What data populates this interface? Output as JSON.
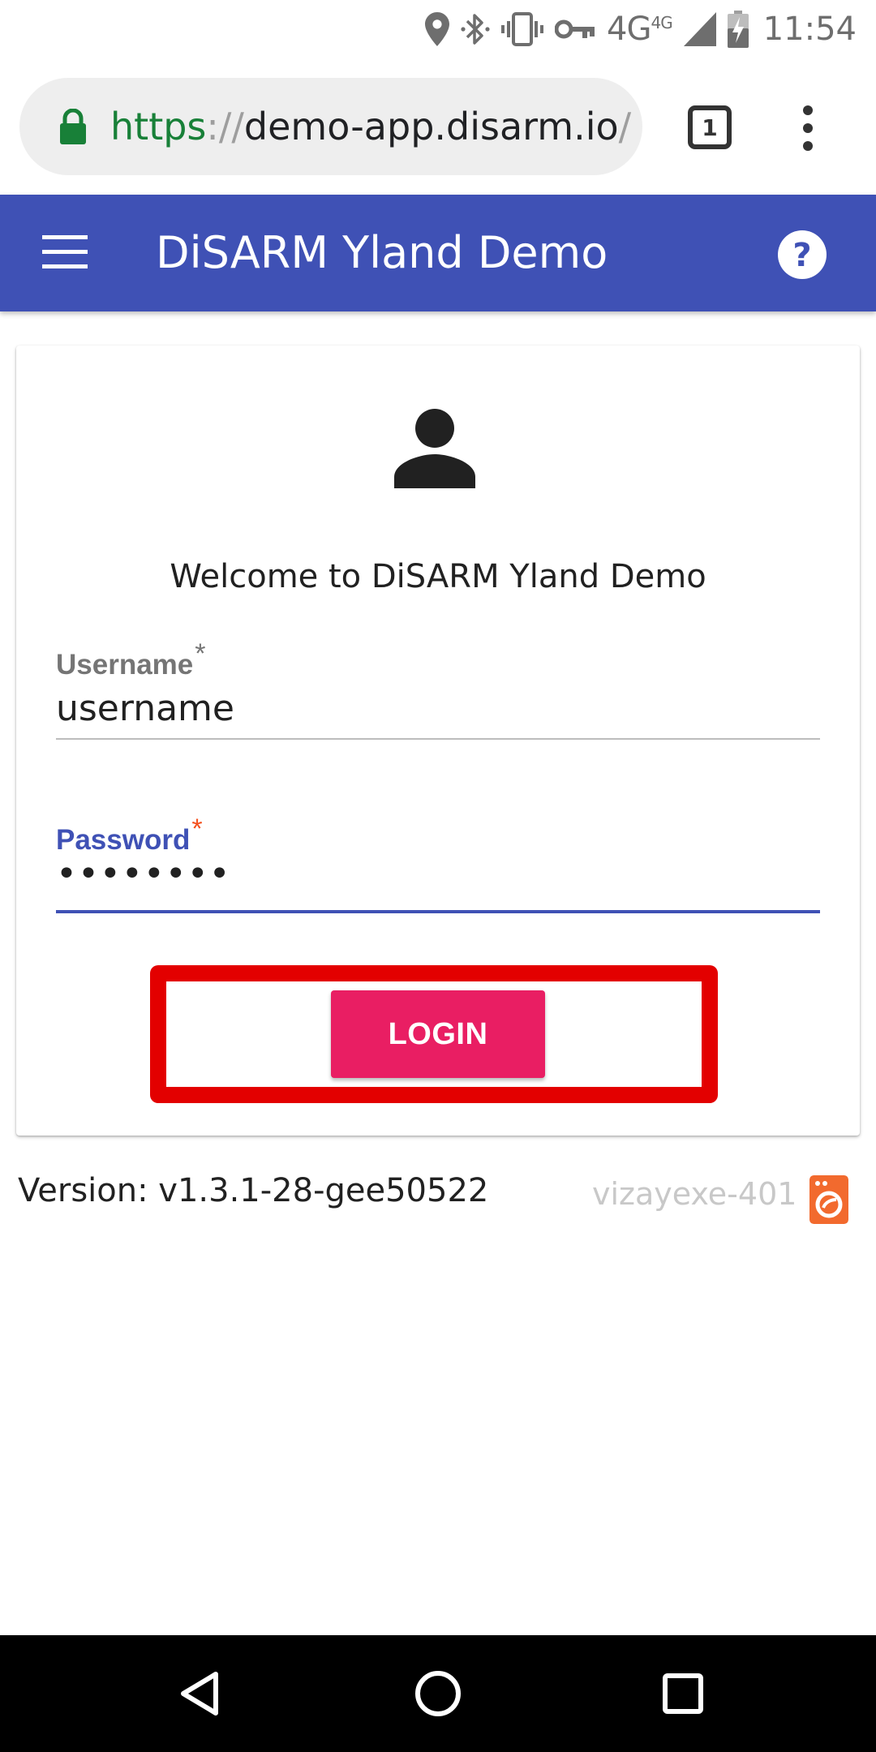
{
  "status_bar": {
    "icons": [
      "location-icon",
      "bluetooth-icon",
      "vibrate-icon",
      "vpn-key-icon",
      "signal-icon",
      "battery-icon"
    ],
    "network": "4G",
    "network_sup": "4G",
    "time": "11:54"
  },
  "browser": {
    "url_scheme": "https",
    "url_sep": "://",
    "url_host": "demo-app.disarm.io",
    "url_path": "/n",
    "tab_count": "1",
    "secure_color": "#188038"
  },
  "app_bar": {
    "title": "DiSARM Yland Demo",
    "color": "#3f51b5"
  },
  "login": {
    "welcome": "Welcome to DiSARM Yland Demo",
    "username_label": "Username",
    "username_required": "*",
    "username_value": "username",
    "password_label": "Password",
    "password_required": "*",
    "password_value": "••••••••",
    "login_label": "LOGIN",
    "button_color": "#e91e63",
    "highlight_color": "#e30000"
  },
  "footer": {
    "version": "Version: v1.3.1-28-gee50522",
    "device_id": "vizayexe-401",
    "badge_color": "#f26a2e"
  },
  "nav_bar": {
    "icons": [
      "back-icon",
      "home-icon",
      "recents-icon"
    ]
  }
}
